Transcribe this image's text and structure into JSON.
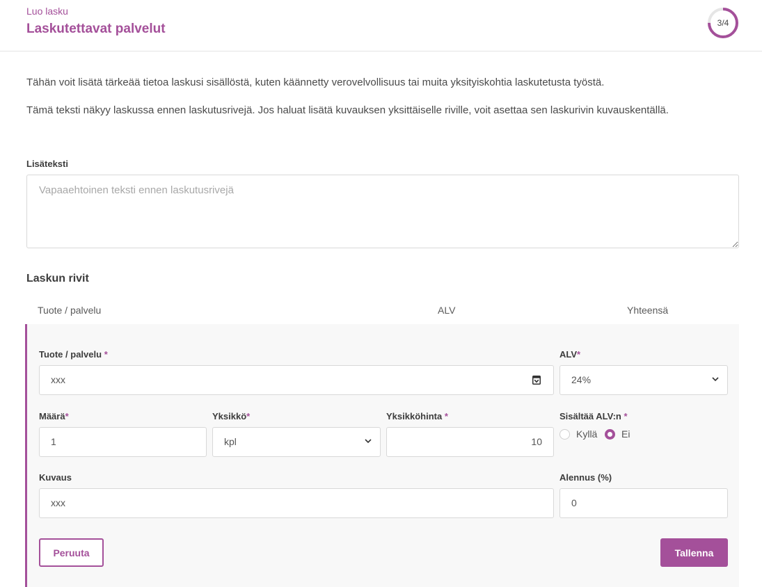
{
  "header": {
    "breadcrumb": "Luo lasku",
    "title": "Laskutettavat palvelut",
    "step": "3/4",
    "step_progress": 0.75
  },
  "intro": {
    "paragraph_1": "Tähän voit lisätä tärkeää tietoa laskusi sisällöstä, kuten käännetty verovelvollisuus tai muita yksityiskohtia laskutetusta työstä.",
    "paragraph_2": "Tämä teksti näkyy laskussa ennen laskutusrivejä. Jos haluat lisätä kuvauksen yksittäiselle riville, voit asettaa sen laskurivin kuvauskentällä."
  },
  "extra_text": {
    "label": "Lisäteksti",
    "placeholder": "Vapaaehtoinen teksti ennen laskutusrivejä",
    "value": ""
  },
  "invoice_rows": {
    "title": "Laskun rivit",
    "columns": [
      "Tuote / palvelu",
      "ALV",
      "Yhteensä"
    ]
  },
  "row_form": {
    "product": {
      "label": "Tuote / palvelu",
      "required": "*",
      "value": "xxx",
      "icon": "list-picker-icon"
    },
    "vat": {
      "label": "ALV",
      "required": "*",
      "value": "24%"
    },
    "quantity": {
      "label": "Määrä",
      "required": "*",
      "value": "1"
    },
    "unit": {
      "label": "Yksikkö",
      "required": "*",
      "value": "kpl"
    },
    "unit_price": {
      "label": "Yksikköhinta",
      "required": "*",
      "value": "10"
    },
    "includes_vat": {
      "label": "Sisältää ALV:n",
      "required": "*",
      "options": [
        "Kyllä",
        "Ei"
      ],
      "selected": "Ei"
    },
    "description": {
      "label": "Kuvaus",
      "value": "xxx"
    },
    "discount": {
      "label": "Alennus (%)",
      "value": "0"
    },
    "cancel_label": "Peruuta",
    "save_label": "Tallenna"
  },
  "colors": {
    "accent": "#a4509a",
    "border": "#d8d8d8",
    "panel_bg": "#f8f8f8"
  }
}
